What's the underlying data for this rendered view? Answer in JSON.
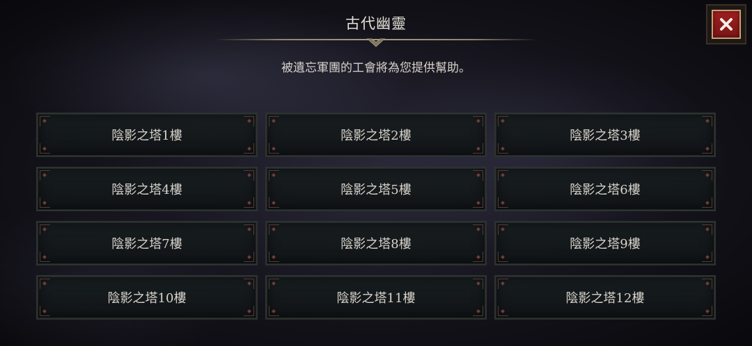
{
  "header": {
    "title": "古代幽靈",
    "subtitle": "被遺忘軍團的工會將為您提供幫助。"
  },
  "close_button": {
    "icon": "close-icon",
    "color": "#a11f1f"
  },
  "floors": [
    {
      "label": "陰影之塔1樓"
    },
    {
      "label": "陰影之塔2樓"
    },
    {
      "label": "陰影之塔3樓"
    },
    {
      "label": "陰影之塔4樓"
    },
    {
      "label": "陰影之塔5樓"
    },
    {
      "label": "陰影之塔6樓"
    },
    {
      "label": "陰影之塔7樓"
    },
    {
      "label": "陰影之塔8樓"
    },
    {
      "label": "陰影之塔9樓"
    },
    {
      "label": "陰影之塔10樓"
    },
    {
      "label": "陰影之塔11樓"
    },
    {
      "label": "陰影之塔12樓"
    }
  ]
}
